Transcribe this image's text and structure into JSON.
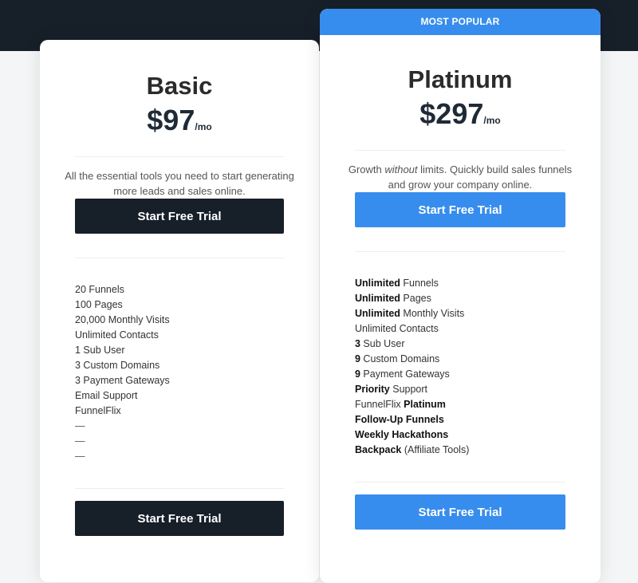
{
  "plans": {
    "basic": {
      "name": "Basic",
      "price": "$97",
      "period": "/mo",
      "description": "All the essential tools you need to start generating more leads and sales online.",
      "cta_top": "Start Free Trial",
      "cta_bottom": "Start Free Trial",
      "features": [
        "20 Funnels",
        "100 Pages",
        "20,000 Monthly Visits",
        "Unlimited Contacts",
        "1 Sub User",
        "3 Custom Domains",
        "3 Payment Gateways",
        "Email Support",
        "FunnelFlix",
        "—",
        "—",
        "—"
      ]
    },
    "platinum": {
      "badge": "MOST POPULAR",
      "name": "Platinum",
      "price": "$297",
      "period": "/mo",
      "description_pre": "Growth ",
      "description_em": "without",
      "description_post": " limits. Quickly build sales funnels and grow your company online.",
      "cta_top": "Start Free Trial",
      "cta_bottom": "Start Free Trial",
      "features": [
        {
          "bold": "Unlimited",
          "text": " Funnels"
        },
        {
          "bold": "Unlimited",
          "text": " Pages"
        },
        {
          "bold": "Unlimited",
          "text": " Monthly Visits"
        },
        {
          "bold": "",
          "text": "Unlimited Contacts"
        },
        {
          "bold": "3",
          "text": " Sub User"
        },
        {
          "bold": "9",
          "text": " Custom Domains"
        },
        {
          "bold": "9",
          "text": " Payment Gateways"
        },
        {
          "bold": "Priority",
          "text": " Support"
        },
        {
          "pre": "FunnelFlix ",
          "bold": "Platinum",
          "text": ""
        },
        {
          "bold": "Follow-Up Funnels",
          "text": ""
        },
        {
          "bold": "Weekly Hackathons",
          "text": ""
        },
        {
          "bold": "Backpack",
          "text": " (Affiliate Tools)"
        }
      ]
    }
  },
  "colors": {
    "header_band": "#171f29",
    "accent_blue": "#378ded",
    "dark_button": "#171f29"
  }
}
